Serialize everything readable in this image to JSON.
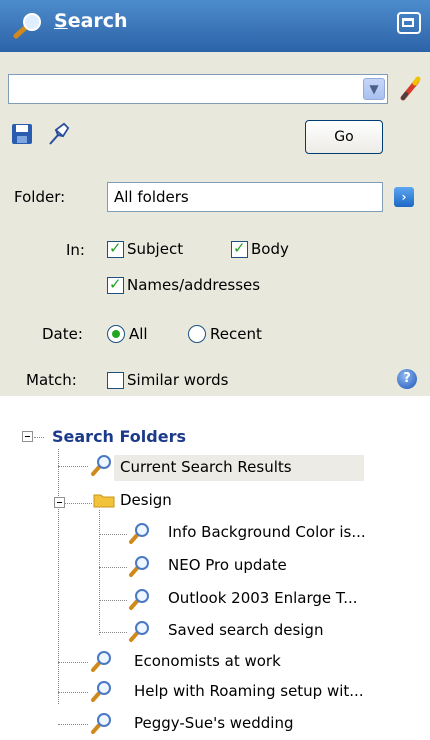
{
  "header": {
    "title_first_letter": "S",
    "title_rest": "earch"
  },
  "search": {
    "query": "",
    "go_label": "Go"
  },
  "folder": {
    "label": "Folder:",
    "value": "All folders"
  },
  "in": {
    "label": "In:",
    "subject": {
      "label": "Subject",
      "checked": true
    },
    "body": {
      "label": "Body",
      "checked": true
    },
    "names": {
      "label": "Names/addresses",
      "checked": true
    }
  },
  "date": {
    "label": "Date:",
    "all": "All",
    "recent": "Recent",
    "selected": "All"
  },
  "match": {
    "label": "Match:",
    "similar": "Similar words",
    "checked": false
  },
  "tree": {
    "root": "Search Folders",
    "current": "Current Search Results",
    "design": "Design",
    "design_children": [
      "Info Background Color is...",
      "NEO Pro update",
      "Outlook 2003  Enlarge T...",
      "Saved search design"
    ],
    "others": [
      "Economists at work",
      "Help with Roaming setup wit...",
      "Peggy-Sue's wedding"
    ]
  },
  "colors": {
    "header_top": "#4d8ccc",
    "header_bottom": "#2c63a8",
    "panel": "#e9e8dc",
    "tree_root": "#1c3a8a",
    "check": "#21a121"
  }
}
